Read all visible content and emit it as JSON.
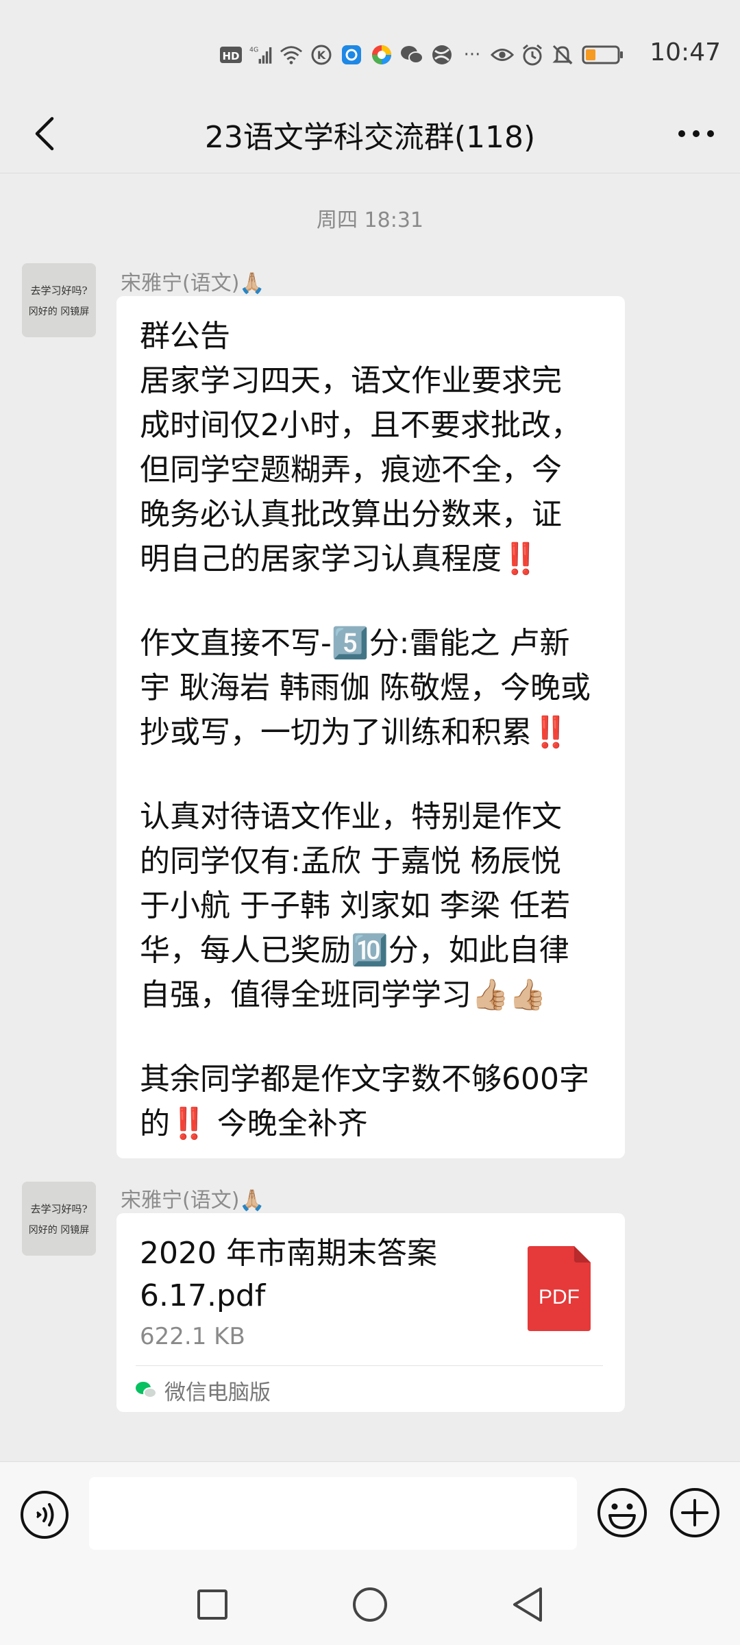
{
  "status_bar": {
    "time": "10:47",
    "icons": [
      "hd-icon",
      "signal-4g-icon",
      "wifi-icon",
      "app-k-icon",
      "app-browser-icon",
      "app-colorful-icon",
      "wechat-icon",
      "app-sphere-icon",
      "more-dots-icon",
      "eye-icon",
      "alarm-icon",
      "mute-icon",
      "battery-icon"
    ],
    "dots": "···"
  },
  "header": {
    "title": "23语文学科交流群(118)"
  },
  "chat": {
    "timestamp": "周四 18:31",
    "messages": [
      {
        "sender": "宋雅宁(语文)🙏🏼",
        "type": "text",
        "avatar_text": [
          "去学习好吗?",
          "冈好的 冈镜屏"
        ],
        "lines": [
          "群公告",
          "居家学习四天，语文作业要求完",
          "成时间仅2小时，且不要求批改，",
          "但同学空题糊弄，痕迹不全，今",
          "晚务必认真批改算出分数来，证",
          "明自己的居家学习认真程度‼️",
          "",
          "作文直接不写-5️⃣分:雷能之 卢新",
          "宇 耿海岩 韩雨伽 陈敬煜，今晚或",
          "抄或写，一切为了训练和积累‼️",
          "",
          "认真对待语文作业，特别是作文",
          "的同学仅有:孟欣 于嘉悦 杨辰悦",
          "于小航 于子韩 刘家如 李梁 任若",
          "华，每人已奖励🔟分，如此自律",
          "自强，值得全班同学学习👍🏼👍🏼",
          "",
          "其余同学都是作文字数不够600字",
          "的‼️ 今晚全补齐"
        ]
      },
      {
        "sender": "宋雅宁(语文)🙏🏼",
        "type": "file",
        "avatar_text": [
          "去学习好吗?",
          "冈好的 冈镜屏"
        ],
        "file_name_line1": "2020 年市南期末答案",
        "file_name_line2": "6.17.pdf",
        "file_size": "622.1 KB",
        "file_icon_label": "PDF",
        "source": "微信电脑版"
      }
    ]
  },
  "input_bar": {
    "placeholder": "",
    "value": ""
  },
  "colors": {
    "background": "#ededed",
    "bubble": "#ffffff",
    "pdf_red": "#e5393a",
    "wechat_green": "#07c160"
  }
}
